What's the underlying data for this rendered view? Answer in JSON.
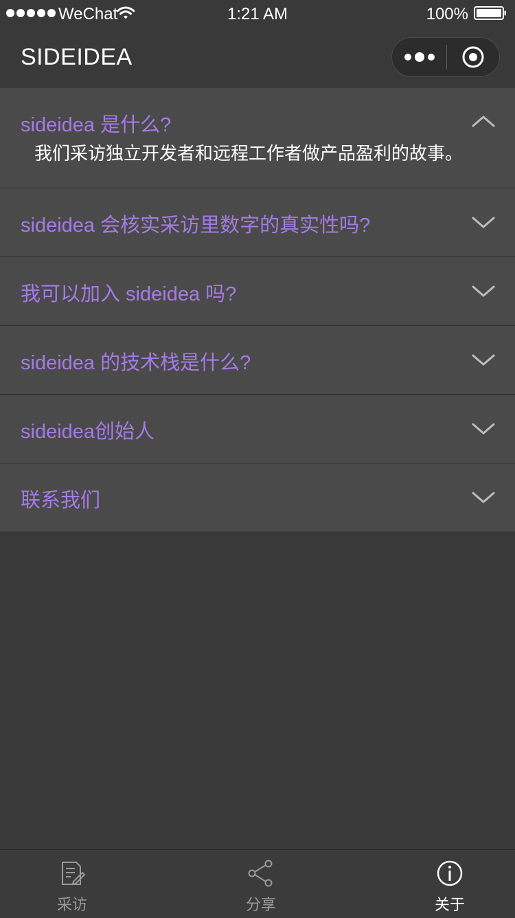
{
  "status_bar": {
    "carrier": "WeChat",
    "time": "1:21 AM",
    "battery": "100%"
  },
  "nav": {
    "title": "SIDEIDEA"
  },
  "faq": [
    {
      "question": "sideidea 是什么?",
      "answer": "我们采访独立开发者和远程工作者做产品盈利的故事。",
      "expanded": true
    },
    {
      "question": "sideidea 会核实采访里数字的真实性吗?",
      "expanded": false
    },
    {
      "question": "我可以加入 sideidea 吗?",
      "expanded": false
    },
    {
      "question": "sideidea 的技术栈是什么?",
      "expanded": false
    },
    {
      "question": "sideidea创始人",
      "expanded": false
    },
    {
      "question": "联系我们",
      "expanded": false
    }
  ],
  "tabs": [
    {
      "label": "采访",
      "icon": "edit-document-icon",
      "active": false
    },
    {
      "label": "分享",
      "icon": "share-icon",
      "active": false
    },
    {
      "label": "关于",
      "icon": "info-icon",
      "active": true
    }
  ],
  "colors": {
    "accent": "#a57ae6",
    "background": "#393939",
    "card": "#4a4a4a"
  }
}
